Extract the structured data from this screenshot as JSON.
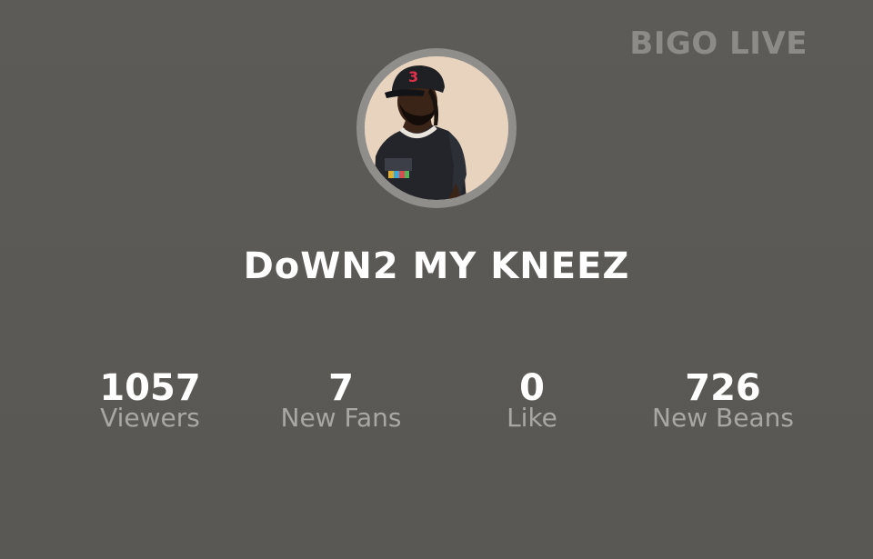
{
  "watermark": "BIGO LIVE",
  "profile": {
    "username": "DoWN2 MY KNEEZ",
    "avatar_icon": "user-photo"
  },
  "stats": [
    {
      "value": "1057",
      "label": "Viewers"
    },
    {
      "value": "7",
      "label": "New Fans"
    },
    {
      "value": "0",
      "label": "Like"
    },
    {
      "value": "726",
      "label": "New Beans"
    }
  ],
  "colors": {
    "background": "#5c5a56",
    "label_gray": "#a9a7a3",
    "watermark_gray": "#8d8b87",
    "avatar_ring": "#8f8e8b"
  }
}
